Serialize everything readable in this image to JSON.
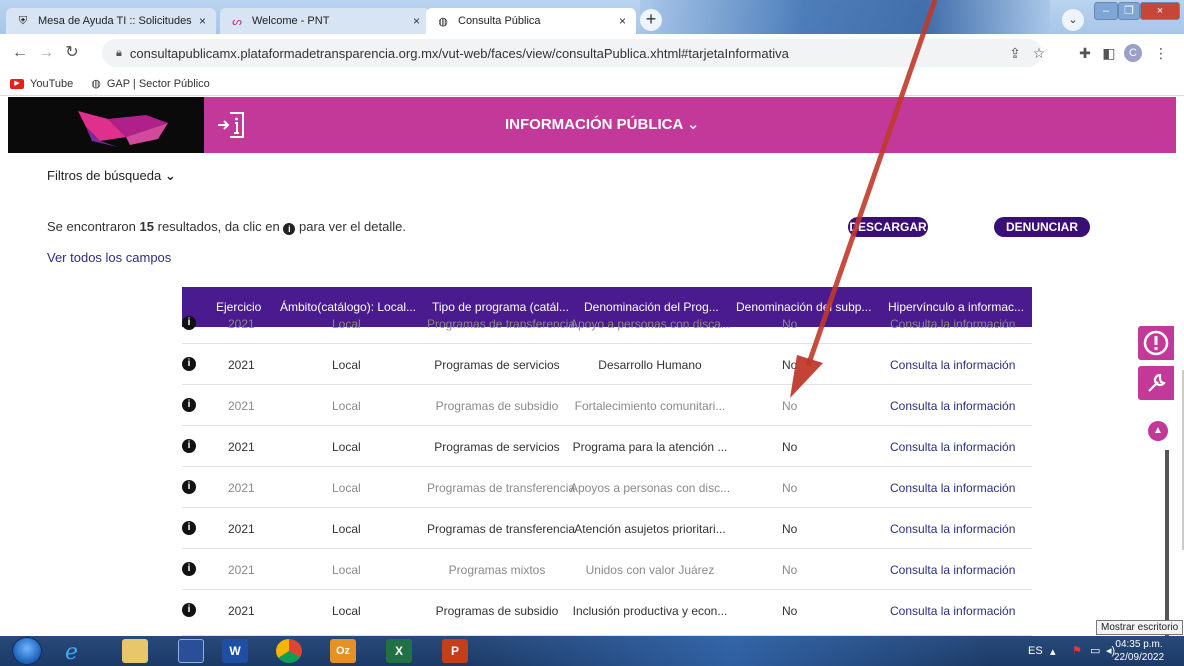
{
  "browser": {
    "tabs": [
      {
        "label": "Mesa de Ayuda TI :: Solicitudes",
        "active": false
      },
      {
        "label": "Welcome - PNT",
        "active": false
      },
      {
        "label": "Consulta Pública",
        "active": true
      }
    ],
    "url": "consultapublicamx.plataformadetransparencia.org.mx/vut-web/faces/view/consultaPublica.xhtml#tarjetaInformativa",
    "bookmarks": [
      "YouTube",
      "GAP | Sector Público"
    ],
    "profile_initial": "C"
  },
  "banner": {
    "title": "INFORMACIÓN PÚBLICA ⌄"
  },
  "filters": {
    "label": "Filtros de búsqueda"
  },
  "results": {
    "prefix": "Se encontraron",
    "count": "15",
    "middle": "resultados, da clic en",
    "suffix": "para ver el detalle."
  },
  "links": {
    "ver_todos": "Ver todos los campos"
  },
  "buttons": {
    "descargar": "DESCARGAR",
    "denunciar": "DENUNCIAR"
  },
  "table": {
    "headers": [
      "Ejercicio",
      "Ámbito(catálogo): Local...",
      "Tipo de programa (catál...",
      "Denominación del Prog...",
      "Denominación del subp...",
      "Hipervínculo a informac..."
    ],
    "rows": [
      {
        "ejercicio": "2021",
        "ambito": "Local",
        "tipo": "Programas de transferencia",
        "denominacion": "Apoyo a personas con disca...",
        "sub": "No",
        "link": "Consulta la información"
      },
      {
        "ejercicio": "2021",
        "ambito": "Local",
        "tipo": "Programas de servicios",
        "denominacion": "Desarrollo Humano",
        "sub": "No",
        "link": "Consulta la información"
      },
      {
        "ejercicio": "2021",
        "ambito": "Local",
        "tipo": "Programas de subsidio",
        "denominacion": "Fortalecimiento comunitari...",
        "sub": "No",
        "link": "Consulta la información"
      },
      {
        "ejercicio": "2021",
        "ambito": "Local",
        "tipo": "Programas de servicios",
        "denominacion": "Programa para la atención ...",
        "sub": "No",
        "link": "Consulta la información"
      },
      {
        "ejercicio": "2021",
        "ambito": "Local",
        "tipo": "Programas de transferencia",
        "denominacion": "Apoyos a personas con disc...",
        "sub": "No",
        "link": "Consulta la información"
      },
      {
        "ejercicio": "2021",
        "ambito": "Local",
        "tipo": "Programas de transferencia",
        "denominacion": "Atención asujetos prioritari...",
        "sub": "No",
        "link": "Consulta la información"
      },
      {
        "ejercicio": "2021",
        "ambito": "Local",
        "tipo": "Programas mixtos",
        "denominacion": "Unidos con valor Juárez",
        "sub": "No",
        "link": "Consulta la información"
      },
      {
        "ejercicio": "2021",
        "ambito": "Local",
        "tipo": "Programas de subsidio",
        "denominacion": "Inclusión productiva y econ...",
        "sub": "No",
        "link": "Consulta la información"
      }
    ]
  },
  "taskbar": {
    "language": "ES",
    "time": "04:35 p.m.",
    "date": "22/09/2022",
    "tooltip": "Mostrar escritorio"
  },
  "colors": {
    "brand_magenta": "#c2399a",
    "header_purple": "#4a1a8f",
    "button_purple": "#3a0f75",
    "arrow": "#c0392b"
  }
}
